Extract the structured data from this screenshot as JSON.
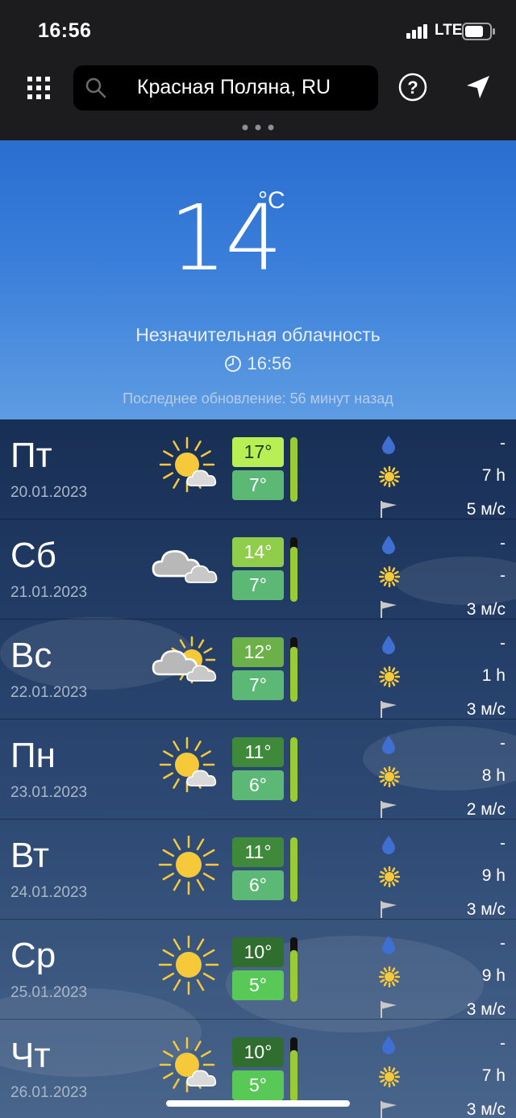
{
  "status_bar": {
    "time": "16:56",
    "network": "LTE"
  },
  "header": {
    "city": "Красная Поляна, RU"
  },
  "current": {
    "temperature": "14",
    "unit": "°C",
    "description": "Незначительная облачность",
    "time": "16:56",
    "last_update": "Последнее обновление: 56 минут назад"
  },
  "days": [
    {
      "name": "Пт",
      "date": "20.01.2023",
      "icon": "sun-cloud-icon",
      "max": "17°",
      "min": "7°",
      "max_color": "#b8ef55",
      "min_color": "#5cb875",
      "bar_level": 1.0,
      "precip": "-",
      "sun": "7 h",
      "wind": "5 м/с"
    },
    {
      "name": "Сб",
      "date": "21.01.2023",
      "icon": "clouds-icon",
      "max": "14°",
      "min": "7°",
      "max_color": "#8fcd4a",
      "min_color": "#5cb875",
      "bar_level": 0.85,
      "precip": "-",
      "sun": "-",
      "wind": "3 м/с"
    },
    {
      "name": "Вс",
      "date": "22.01.2023",
      "icon": "clouds-sun-icon",
      "max": "12°",
      "min": "7°",
      "max_color": "#6cb04a",
      "min_color": "#5cb875",
      "bar_level": 0.85,
      "precip": "-",
      "sun": "1 h",
      "wind": "3 м/с"
    },
    {
      "name": "Пн",
      "date": "23.01.2023",
      "icon": "sun-cloud-icon",
      "max": "11°",
      "min": "6°",
      "max_color": "#3f8a3a",
      "min_color": "#5cb875",
      "bar_level": 1.0,
      "precip": "-",
      "sun": "8 h",
      "wind": "2 м/с"
    },
    {
      "name": "Вт",
      "date": "24.01.2023",
      "icon": "sun-icon",
      "max": "11°",
      "min": "6°",
      "max_color": "#3f8a3a",
      "min_color": "#5cb875",
      "bar_level": 1.0,
      "precip": "-",
      "sun": "9 h",
      "wind": "3 м/с"
    },
    {
      "name": "Ср",
      "date": "25.01.2023",
      "icon": "sun-icon",
      "max": "10°",
      "min": "5°",
      "max_color": "#2f6e2e",
      "min_color": "#58c857",
      "bar_level": 0.8,
      "precip": "-",
      "sun": "9 h",
      "wind": "3 м/с"
    },
    {
      "name": "Чт",
      "date": "26.01.2023",
      "icon": "sun-cloud-icon",
      "max": "10°",
      "min": "5°",
      "max_color": "#2f6e2e",
      "min_color": "#58c857",
      "bar_level": 0.8,
      "precip": "-",
      "sun": "7 h",
      "wind": "3 м/с"
    }
  ],
  "colors": {
    "sun": "#f5c93a",
    "bar": "#9acb35",
    "drop": "#3e6fd1"
  }
}
